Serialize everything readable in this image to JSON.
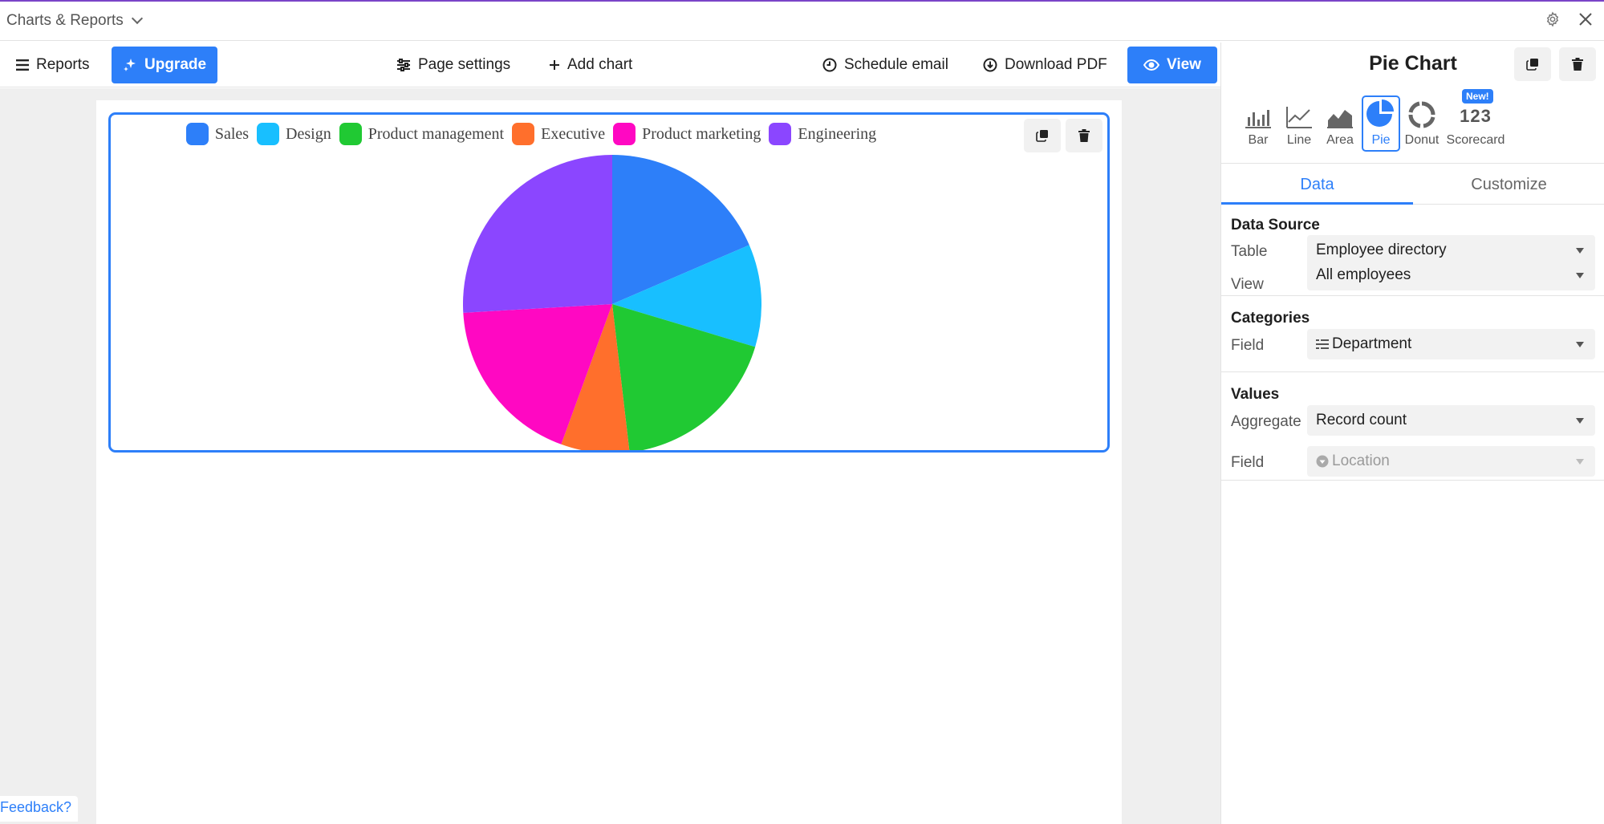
{
  "window": {
    "title": "Charts & Reports"
  },
  "toolbar": {
    "reports_label": "Reports",
    "upgrade_label": "Upgrade",
    "page_settings_label": "Page settings",
    "add_chart_label": "Add chart",
    "schedule_email_label": "Schedule email",
    "download_pdf_label": "Download PDF",
    "view_label": "View"
  },
  "feedback_label": "Feedback?",
  "panel": {
    "title": "Pie Chart",
    "chart_types": [
      {
        "label": "Bar",
        "icon": "bar-chart-icon"
      },
      {
        "label": "Line",
        "icon": "line-chart-icon"
      },
      {
        "label": "Area",
        "icon": "area-chart-icon"
      },
      {
        "label": "Pie",
        "icon": "pie-chart-icon",
        "selected": true
      },
      {
        "label": "Donut",
        "icon": "donut-chart-icon"
      },
      {
        "label": "Scorecard",
        "icon": "scorecard-icon",
        "glyph": "123",
        "badge": "New!"
      }
    ],
    "tabs": [
      {
        "label": "Data",
        "active": true
      },
      {
        "label": "Customize",
        "active": false
      }
    ],
    "data_source": {
      "title": "Data Source",
      "table_label": "Table",
      "table_value": "Employee directory",
      "view_label": "View",
      "view_value": "All employees"
    },
    "categories": {
      "title": "Categories",
      "field_label": "Field",
      "field_value": "Department"
    },
    "values": {
      "title": "Values",
      "aggregate_label": "Aggregate",
      "aggregate_value": "Record count",
      "field_label": "Field",
      "field_value": "Location"
    }
  },
  "colors": {
    "accent": "#2d7ff9",
    "sales": "#2d7ff9",
    "design": "#18bfff",
    "product_management": "#20c933",
    "executive": "#ff6f2c",
    "product_marketing": "#ff08c2",
    "engineering": "#8b46ff"
  },
  "chart_data": {
    "type": "pie",
    "categories": [
      "Sales",
      "Design",
      "Product management",
      "Executive",
      "Product marketing",
      "Engineering"
    ],
    "values": [
      5,
      3,
      5,
      2,
      5,
      7
    ],
    "colors": [
      "#2d7ff9",
      "#18bfff",
      "#20c933",
      "#ff6f2c",
      "#ff08c2",
      "#8b46ff"
    ],
    "legend": "top"
  }
}
